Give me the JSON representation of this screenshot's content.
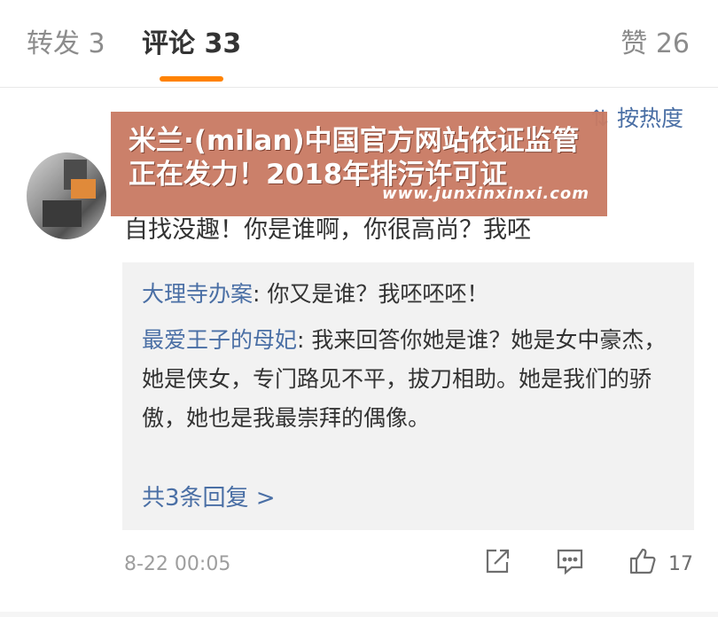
{
  "tabs": {
    "repost": "转发 3",
    "comment": "评论 33",
    "likes": "赞 26"
  },
  "sort": {
    "icon": "sort-icon",
    "label": "按热度"
  },
  "banner": {
    "title": "米兰·(milan)中国官方网站依证监管正在发力！2018年排污许可证",
    "url": "www.junxinxinxi.com"
  },
  "comment": {
    "text": "自找没趣！你是谁啊，你很高尚？我呸",
    "date": "8-22 00:05",
    "like_count": "17"
  },
  "replies": [
    {
      "name": "大理寺办案",
      "text": ": 你又是谁？我呸呸呸！"
    },
    {
      "name": "最爱王子的母妃",
      "text": ": 我来回答你她是谁？她是女中豪杰，她是侠女，专门路见不平，拔刀相助。她是我们的骄傲，她也是我最崇拜的偶像。"
    }
  ],
  "more_replies": "共3条回复 >",
  "colors": {
    "accent": "#ff8200",
    "link": "#4a6fa5",
    "banner": "#c97b64"
  }
}
